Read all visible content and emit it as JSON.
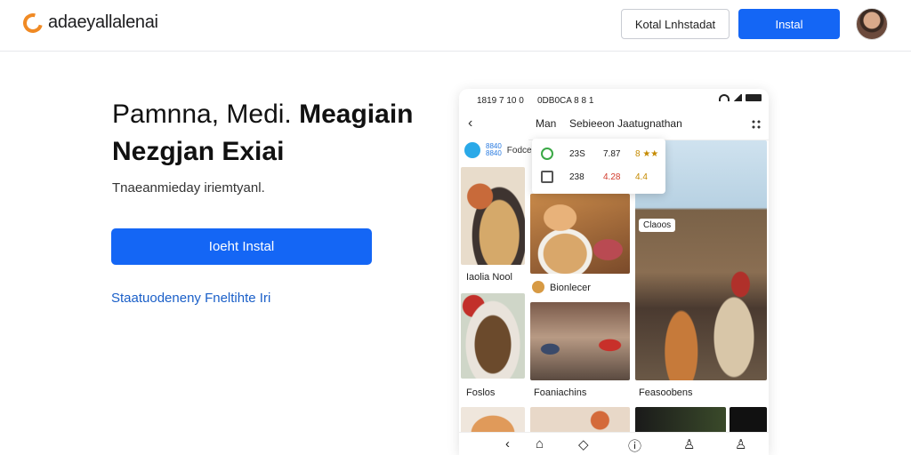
{
  "header": {
    "logo_text": "adaeyallalenai",
    "secondary_button": "Kotal Lnhstadat",
    "primary_button": "Instal",
    "brand_color": "#1466f5",
    "logo_color": "#f08a24"
  },
  "hero": {
    "title_light": "Pamnna, Medi.",
    "title_bold_1": "Meagiain",
    "title_bold_2": "Nezgjan Exiai",
    "subtitle": "Tnaeanmieday iriemtyanl.",
    "cta": "Ioeht Instal",
    "link": "Staatuodeneny Fneltihte Iri"
  },
  "phone": {
    "status_left": "1819 7 10 0",
    "status_mid": "0DB0CA 8 8 1",
    "topbar_title": "Man",
    "topbar_subtitle": "Sebieeon Jaatugnathan",
    "mini_badge_top": "8840",
    "mini_badge_bottom": "8840",
    "mini_label": "Fodce",
    "popup": {
      "row1": {
        "a": "23S",
        "b": "7.87",
        "c": "8 ★★"
      },
      "row2": {
        "a": "238",
        "b": "4.28",
        "c": "4.4"
      }
    },
    "cards": {
      "left_1": "Iaolia Nool",
      "left_2": "Foslos",
      "mid_header": "Bionlecer",
      "mid_2": "Foaniachins",
      "right_tag": "Claoos",
      "right_2": "Feasoobens"
    },
    "nav_icons": [
      "back-icon",
      "home-icon",
      "tag-icon",
      "info-icon",
      "profile-icon",
      "user-icon"
    ]
  }
}
